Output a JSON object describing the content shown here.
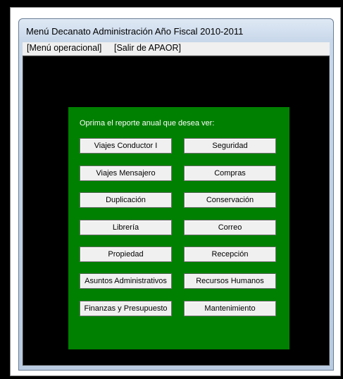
{
  "window": {
    "title": "Menú Decanato Administración Año Fiscal 2010-2011"
  },
  "menubar": {
    "items": [
      {
        "label": "[Menú operacional]"
      },
      {
        "label": "[Salir de APAOR]"
      }
    ]
  },
  "panel": {
    "prompt": "Oprima el reporte anual que desea ver:",
    "buttons_left": [
      {
        "label": "Viajes Conductor I"
      },
      {
        "label": "Viajes Mensajero"
      },
      {
        "label": "Duplicación"
      },
      {
        "label": "Librería"
      },
      {
        "label": "Propiedad"
      },
      {
        "label": "Asuntos Administrativos"
      },
      {
        "label": "Finanzas y Presupuesto"
      }
    ],
    "buttons_right": [
      {
        "label": "Seguridad"
      },
      {
        "label": "Compras"
      },
      {
        "label": "Conservación"
      },
      {
        "label": "Correo"
      },
      {
        "label": "Recepción"
      },
      {
        "label": "Recursos Humanos"
      },
      {
        "label": "Mantenimiento"
      }
    ]
  },
  "colors": {
    "panel_green": "#008000",
    "client_black": "#000000",
    "button_face": "#f0f0f0"
  }
}
